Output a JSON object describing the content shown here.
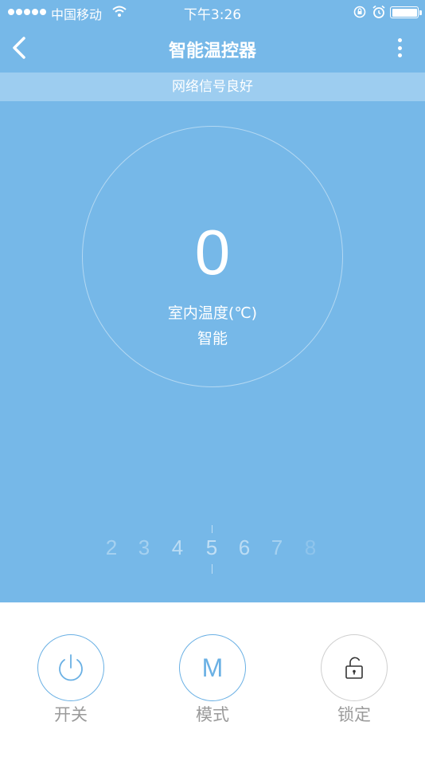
{
  "status_bar": {
    "carrier": "中国移动",
    "time": "下午3:26"
  },
  "nav": {
    "title": "智能温控器"
  },
  "network": {
    "message": "网络信号良好"
  },
  "thermostat": {
    "temperature": "0",
    "temperature_label": "室内温度(℃)",
    "mode": "智能"
  },
  "picker": {
    "numbers": [
      "2",
      "3",
      "4",
      "5",
      "6",
      "7",
      "8"
    ],
    "selected": "5"
  },
  "controls": {
    "power_label": "开关",
    "mode_label": "模式",
    "mode_symbol": "M",
    "lock_label": "锁定"
  },
  "colors": {
    "background": "#76b8e8",
    "accent": "#6ab0e4",
    "signal_bar": "#9dcdf0"
  }
}
